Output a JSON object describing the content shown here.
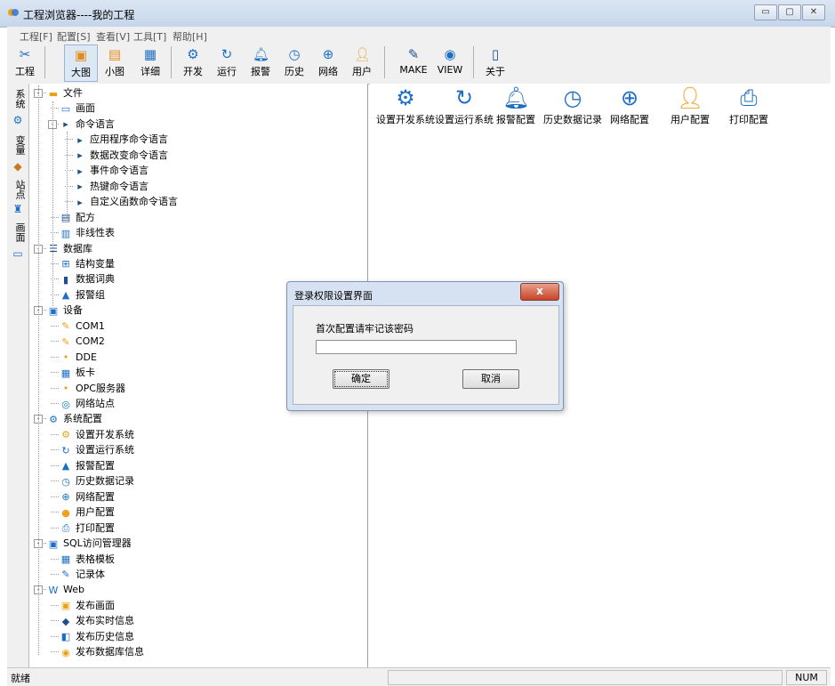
{
  "window": {
    "title": "工程浏览器----我的工程",
    "controls": {
      "minimize": "▭",
      "maximize": "▢",
      "close": "✕"
    }
  },
  "menubar": {
    "items": [
      "工程[F]",
      "配置[S]",
      "查看[V]",
      "工具[T]",
      "帮助[H]"
    ]
  },
  "toolbar": {
    "buttons": [
      {
        "label": "工程",
        "icon": "tools-icon"
      },
      {
        "label": "大图",
        "icon": "large-icons-icon"
      },
      {
        "label": "小图",
        "icon": "small-icons-icon"
      },
      {
        "label": "详细",
        "icon": "details-icon"
      },
      {
        "label": "开发",
        "icon": "develop-gear-icon"
      },
      {
        "label": "运行",
        "icon": "run-icon"
      },
      {
        "label": "报警",
        "icon": "alarm-bell-icon"
      },
      {
        "label": "历史",
        "icon": "history-clock-icon"
      },
      {
        "label": "网络",
        "icon": "network-globe-icon"
      },
      {
        "label": "用户",
        "icon": "user-icon"
      },
      {
        "label": "MAKE",
        "icon": "make-icon"
      },
      {
        "label": "VIEW",
        "icon": "view-eye-icon"
      },
      {
        "label": "关于",
        "icon": "about-book-icon"
      }
    ]
  },
  "vtabs": [
    "系统",
    "变量",
    "站点",
    "画面"
  ],
  "tree": [
    {
      "label": "文件",
      "icon": "folder-icon",
      "level": 0,
      "expander": "-"
    },
    {
      "label": "画面",
      "icon": "screen-icon",
      "level": 1
    },
    {
      "label": "命令语言",
      "icon": "command-icon",
      "level": 1,
      "expander": "-"
    },
    {
      "label": "应用程序命令语言",
      "icon": "command-icon",
      "level": 2
    },
    {
      "label": "数据改变命令语言",
      "icon": "command-icon",
      "level": 2
    },
    {
      "label": "事件命令语言",
      "icon": "command-icon",
      "level": 2
    },
    {
      "label": "热键命令语言",
      "icon": "command-icon",
      "level": 2
    },
    {
      "label": "自定义函数命令语言",
      "icon": "command-icon",
      "level": 2
    },
    {
      "label": "配方",
      "icon": "recipe-icon",
      "level": 1
    },
    {
      "label": "非线性表",
      "icon": "table-chart-icon",
      "level": 1
    },
    {
      "label": "数据库",
      "icon": "database-icon",
      "level": 0,
      "expander": "-"
    },
    {
      "label": "结构变量",
      "icon": "struct-icon",
      "level": 1
    },
    {
      "label": "数据词典",
      "icon": "dictionary-icon",
      "level": 1
    },
    {
      "label": "报警组",
      "icon": "alarm-bell-icon",
      "level": 1
    },
    {
      "label": "设备",
      "icon": "device-icon",
      "level": 0,
      "expander": "-"
    },
    {
      "label": "COM1",
      "icon": "serial-port-icon",
      "level": 1
    },
    {
      "label": "COM2",
      "icon": "serial-port-icon",
      "level": 1
    },
    {
      "label": "DDE",
      "icon": "dde-icon",
      "level": 1
    },
    {
      "label": "板卡",
      "icon": "card-icon",
      "level": 1
    },
    {
      "label": "OPC服务器",
      "icon": "opc-icon",
      "level": 1
    },
    {
      "label": "网络站点",
      "icon": "network-site-icon",
      "level": 1
    },
    {
      "label": "系统配置",
      "icon": "system-config-icon",
      "level": 0,
      "expander": "-"
    },
    {
      "label": "设置开发系统",
      "icon": "develop-gear-icon",
      "level": 1
    },
    {
      "label": "设置运行系统",
      "icon": "run-icon",
      "level": 1
    },
    {
      "label": "报警配置",
      "icon": "alarm-bell-icon",
      "level": 1
    },
    {
      "label": "历史数据记录",
      "icon": "history-clock-icon",
      "level": 1
    },
    {
      "label": "网络配置",
      "icon": "network-globe-icon",
      "level": 1
    },
    {
      "label": "用户配置",
      "icon": "user-icon",
      "level": 1
    },
    {
      "label": "打印配置",
      "icon": "printer-icon",
      "level": 1
    },
    {
      "label": "SQL访问管理器",
      "icon": "sql-icon",
      "level": 0,
      "expander": "-"
    },
    {
      "label": "表格模板",
      "icon": "grid-template-icon",
      "level": 1
    },
    {
      "label": "记录体",
      "icon": "record-icon",
      "level": 1
    },
    {
      "label": "Web",
      "icon": "web-icon",
      "level": 0,
      "expander": "-"
    },
    {
      "label": "发布画面",
      "icon": "publish-screen-icon",
      "level": 1
    },
    {
      "label": "发布实时信息",
      "icon": "publish-realtime-icon",
      "level": 1
    },
    {
      "label": "发布历史信息",
      "icon": "publish-history-icon",
      "level": 1
    },
    {
      "label": "发布数据库信息",
      "icon": "publish-db-icon",
      "level": 1
    }
  ],
  "content": {
    "items": [
      {
        "label": "设置开发系统",
        "icon": "develop-gear-icon"
      },
      {
        "label": "设置运行系统",
        "icon": "run-icon"
      },
      {
        "label": "报警配置",
        "icon": "alarm-bell-icon"
      },
      {
        "label": "历史数据记录",
        "icon": "history-clock-icon"
      },
      {
        "label": "网络配置",
        "icon": "network-globe-icon"
      },
      {
        "label": "用户配置",
        "icon": "user-icon"
      },
      {
        "label": "打印配置",
        "icon": "printer-icon"
      }
    ]
  },
  "dialog": {
    "title": "登录权限设置界面",
    "prompt": "首次配置请牢记该密码",
    "password_value": "",
    "ok_label": "确定",
    "cancel_label": "取消",
    "close_glyph": "x"
  },
  "statusbar": {
    "left_text": "就绪",
    "num_indicator": "NUM"
  },
  "colors": {
    "title_gradient_top": "#dbe6f3",
    "dialog_frame": "#d6e2f1",
    "close_red": "#c7432a",
    "blue_icon": "#1c6fc4",
    "orange_icon": "#f0a020"
  }
}
